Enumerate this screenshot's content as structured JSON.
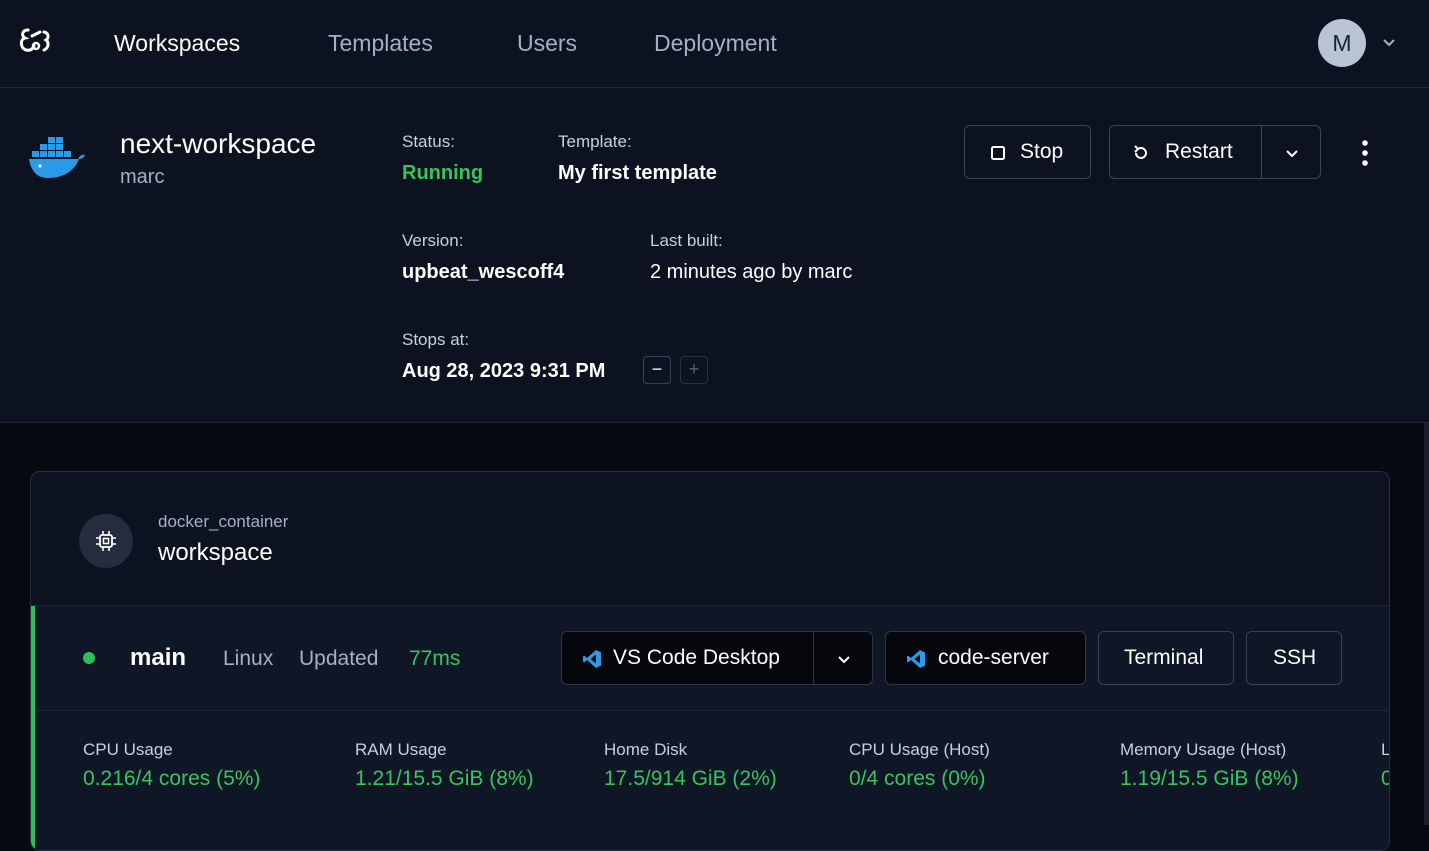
{
  "nav": {
    "items": [
      {
        "label": "Workspaces",
        "active": true
      },
      {
        "label": "Templates"
      },
      {
        "label": "Users"
      },
      {
        "label": "Deployment"
      }
    ],
    "avatar_initial": "M"
  },
  "workspace": {
    "name": "next-workspace",
    "owner": "marc",
    "status_label": "Status:",
    "status_value": "Running",
    "template_label": "Template:",
    "template_value": "My first template",
    "version_label": "Version:",
    "version_value": "upbeat_wescoff4",
    "last_built_label": "Last built:",
    "last_built_value": "2 minutes ago by marc",
    "stops_at_label": "Stops at:",
    "stops_at_value": "Aug 28, 2023 9:31 PM",
    "decrease_label": "−",
    "increase_label": "+",
    "stop_label": "Stop",
    "restart_label": "Restart"
  },
  "resource": {
    "type": "docker_container",
    "name": "workspace",
    "agent": {
      "name": "main",
      "os": "Linux",
      "updated_label": "Updated",
      "latency": "77ms",
      "apps": {
        "vscode_desktop": "VS Code Desktop",
        "code_server": "code-server",
        "terminal": "Terminal",
        "ssh": "SSH"
      },
      "stats": [
        {
          "label": "CPU Usage",
          "value": "0.216/4 cores (5%)"
        },
        {
          "label": "RAM Usage",
          "value": "1.21/15.5 GiB (8%)"
        },
        {
          "label": "Home Disk",
          "value": "17.5/914 GiB (2%)"
        },
        {
          "label": "CPU Usage (Host)",
          "value": "0/4 cores (0%)"
        },
        {
          "label": "Memory Usage (Host)",
          "value": "1.19/15.5 GiB (8%)"
        },
        {
          "label": "L",
          "value": "0"
        }
      ]
    }
  },
  "colors": {
    "accent_green": "#37c45f",
    "background": "#0d1220",
    "vscode_blue": "#2b9ae8"
  }
}
